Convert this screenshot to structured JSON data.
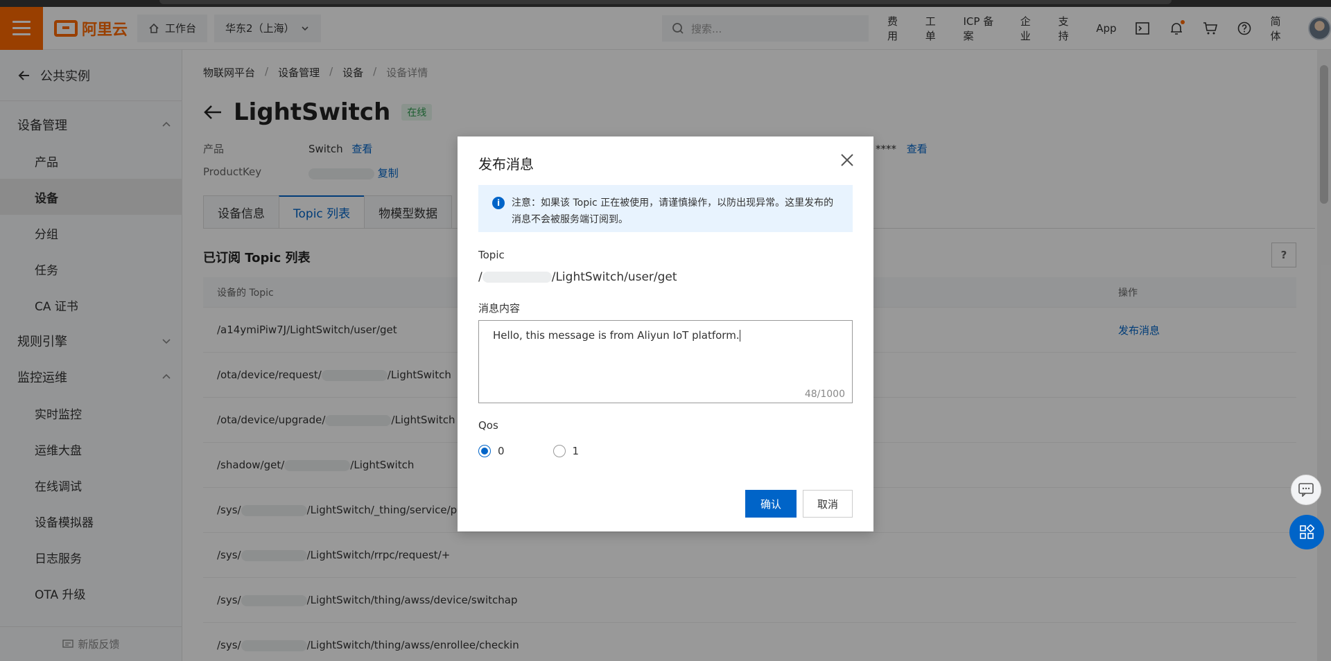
{
  "header": {
    "brand": "阿里云",
    "workbench": "工作台",
    "region": "华东2（上海）",
    "search_placeholder": "搜索...",
    "links": [
      "费用",
      "工单",
      "ICP 备案",
      "企业",
      "支持",
      "App"
    ],
    "lang": "简体",
    "accent_color": "#ff6a00"
  },
  "sidebar": {
    "back_label": "公共实例",
    "group_device": "设备管理",
    "items_device": [
      "产品",
      "设备",
      "分组",
      "任务",
      "CA 证书"
    ],
    "group_rules": "规则引擎",
    "group_ops": "监控运维",
    "items_ops": [
      "实时监控",
      "运维大盘",
      "在线调试",
      "设备模拟器",
      "日志服务",
      "OTA 升级"
    ],
    "feedback": "新版反馈"
  },
  "main": {
    "breadcrumb": [
      "物联网平台",
      "设备管理",
      "设备",
      "设备详情"
    ],
    "title": "LightSwitch",
    "status": "在线",
    "product_label": "产品",
    "product_value": "Switch",
    "view_link": "查看",
    "productkey_label": "ProductKey",
    "copy_link": "复制",
    "secret_tail": "****",
    "secret_view": "查看",
    "tabs": [
      "设备信息",
      "Topic 列表",
      "物模型数据"
    ],
    "section_title": "已订阅 Topic 列表",
    "help": "?",
    "table": {
      "col_topic": "设备的 Topic",
      "col_op": "操作",
      "rows": [
        {
          "pre": "/a14ymiPiw7J/LightSwitch/user/get",
          "post": "",
          "op": "发布消息"
        },
        {
          "pre": "/ota/device/request/",
          "post": "/LightSwitch",
          "op": ""
        },
        {
          "pre": "/ota/device/upgrade/",
          "post": "/LightSwitch",
          "op": ""
        },
        {
          "pre": "/shadow/get/",
          "post": "/LightSwitch",
          "op": ""
        },
        {
          "pre": "/sys/",
          "post": "/LightSwitch/_thing/service/post_re",
          "op": ""
        },
        {
          "pre": "/sys/",
          "post": "/LightSwitch/rrpc/request/+",
          "op": ""
        },
        {
          "pre": "/sys/",
          "post": "/LightSwitch/thing/awss/device/switchap",
          "op": ""
        },
        {
          "pre": "/sys/",
          "post": "/LightSwitch/thing/awss/enrollee/checkin",
          "op": ""
        }
      ]
    }
  },
  "modal": {
    "title": "发布消息",
    "notice": "注意：如果该 Topic 正在被使用，请谨慎操作，以防出现异常。这里发布的消息不会被服务端订阅到。",
    "topic_label": "Topic",
    "topic_prefix": "/",
    "topic_suffix": "/LightSwitch/user/get",
    "message_label": "消息内容",
    "message_value": "Hello, this message is from Aliyun IoT platform.",
    "char_count": "48/1000",
    "qos_label": "Qos",
    "qos_options": [
      "0",
      "1"
    ],
    "qos_selected": "0",
    "confirm": "确认",
    "cancel": "取消",
    "primary_color": "#0064c8"
  }
}
